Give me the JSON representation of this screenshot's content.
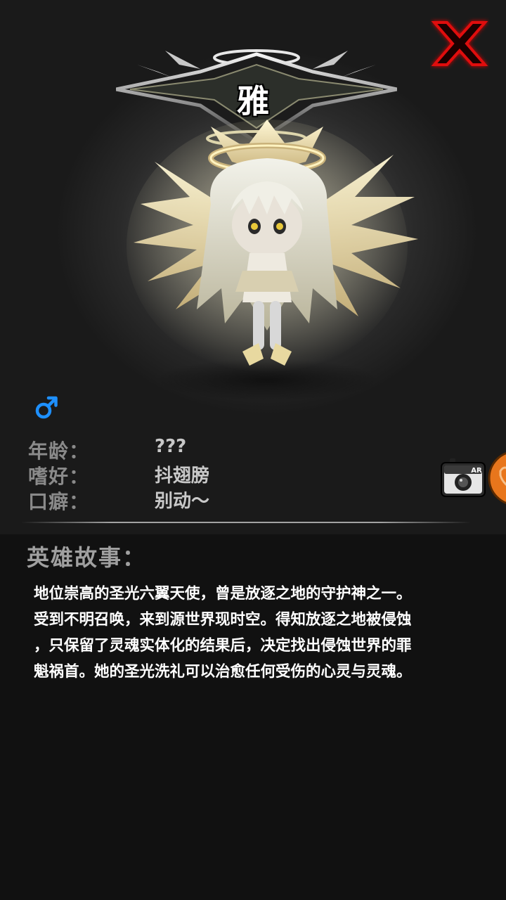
{
  "hero": {
    "name": "雅",
    "gender_icon": "male-symbol-icon",
    "gender_color": "#1e90ff"
  },
  "info": [
    {
      "label": "年龄：",
      "value": "???"
    },
    {
      "label": "嗜好：",
      "value": "抖翅膀"
    },
    {
      "label": "口癖：",
      "value": "别动～"
    }
  ],
  "story": {
    "heading": "英雄故事：",
    "lines": [
      "地位崇高的圣光六翼天使，曾是放逐之地的守护神之一。",
      "受到不明召唤，来到源世界现时空。得知放逐之地被侵蚀",
      "，只保留了灵魂实体化的结果后，决定找出侵蚀世界的罪",
      "魁祸首。她的圣光洗礼可以治愈任何受伤的心灵与灵魂。"
    ]
  },
  "controls": {
    "close_icon": "red-x-close-icon",
    "ar_label": "AR",
    "ar_icon": "ar-camera-icon",
    "side_tab_icon": "orange-side-tab-icon"
  },
  "colors": {
    "background": "#111111",
    "close_red": "#e01010",
    "side_tab_orange": "#e8761c",
    "label_gray": "#8a8a8a",
    "value_gray": "#c8c8c8"
  }
}
